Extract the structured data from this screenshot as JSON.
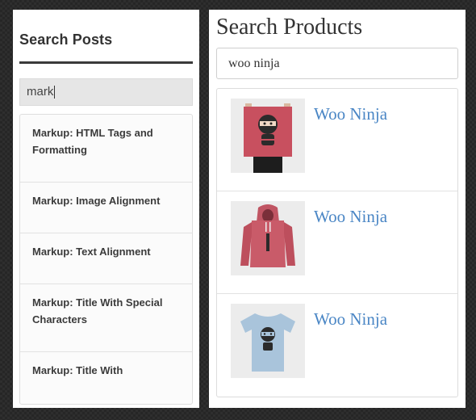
{
  "posts_widget": {
    "title": "Search Posts",
    "search_value": "mark",
    "results": [
      "Markup: HTML Tags and Formatting",
      "Markup: Image Alignment",
      "Markup: Text Alignment",
      "Markup: Title With Special Characters",
      "Markup: Title With"
    ]
  },
  "products_widget": {
    "title": "Search Products",
    "search_value": "woo ninja",
    "results": [
      {
        "name": "Woo Ninja",
        "image": "ninja-poster-image"
      },
      {
        "name": "Woo Ninja",
        "image": "ninja-hoodie-image"
      },
      {
        "name": "Woo Ninja",
        "image": "ninja-tshirt-image"
      }
    ]
  },
  "colors": {
    "page_background": "#262626",
    "link": "#4a86c5",
    "title_rule": "#3a3a3a"
  }
}
